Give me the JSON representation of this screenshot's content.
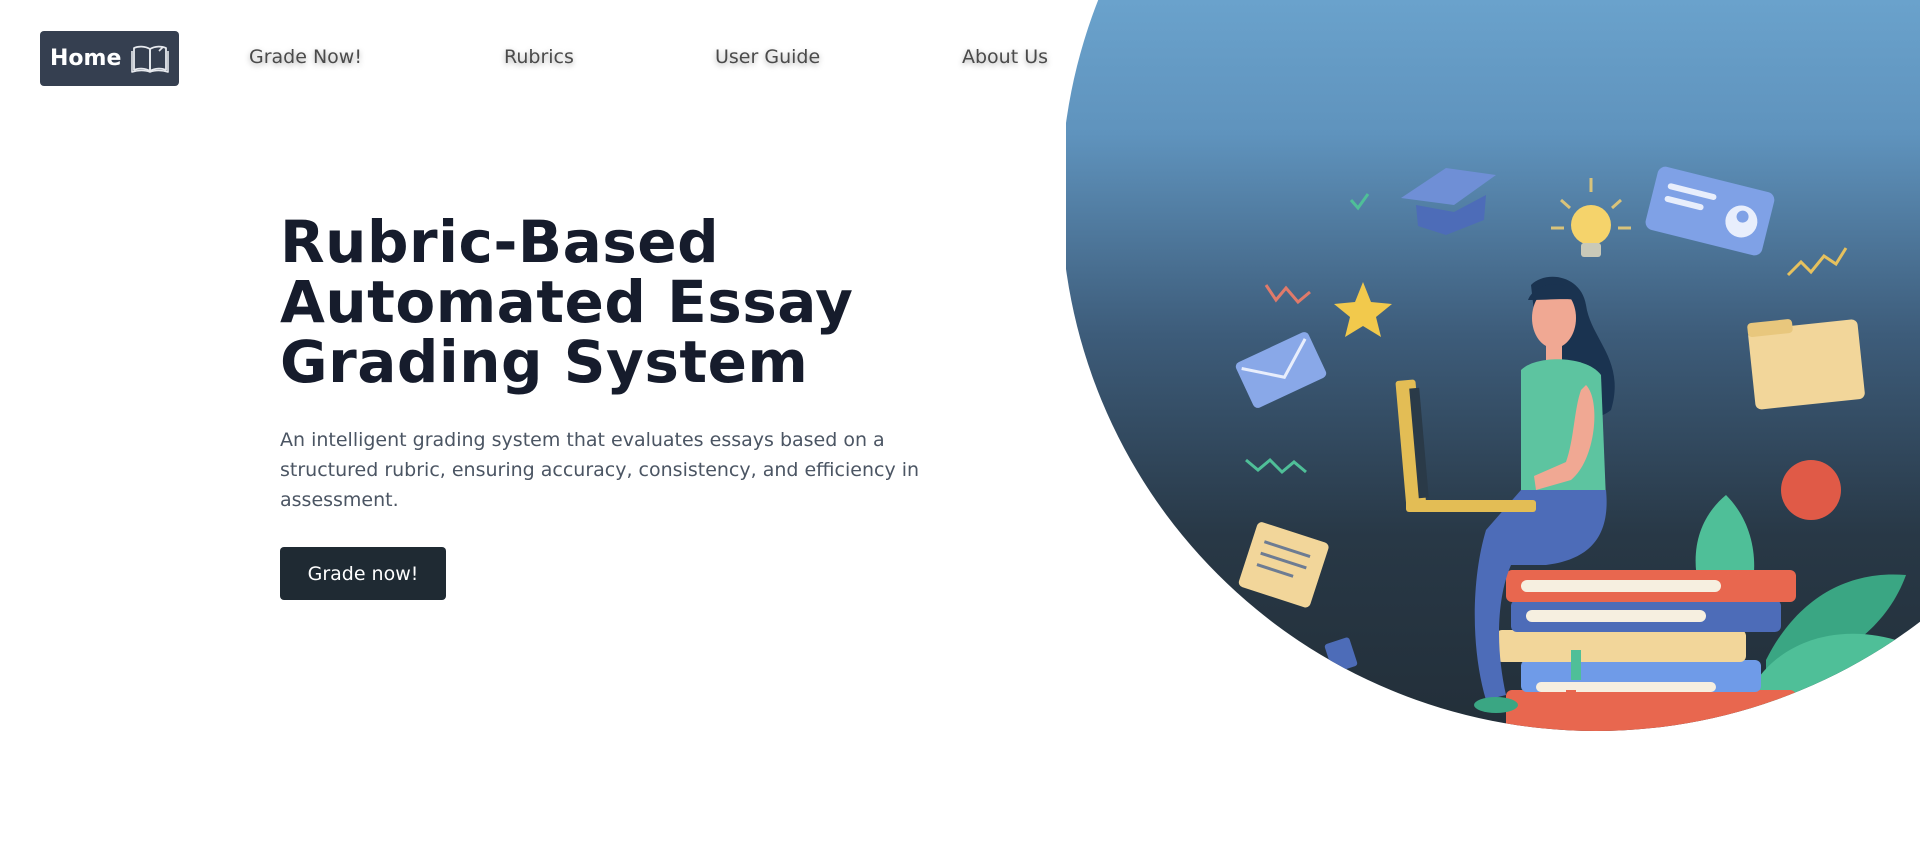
{
  "nav": {
    "home_label": "Home",
    "links": [
      "Grade Now!",
      "Rubrics",
      "User Guide",
      "About Us"
    ]
  },
  "hero": {
    "title_lines": [
      "Rubric-Based",
      "Automated Essay",
      "Grading System"
    ],
    "description": "An intelligent grading system that evaluates essays based on a structured rubric, ensuring accuracy, consistency, and efficiency in assessment.",
    "cta_label": "Grade now!"
  },
  "icons": {
    "home": "open-book-icon",
    "illustration": "student-with-laptop-on-books-illustration"
  },
  "colors": {
    "primary_dark": "#1f2a33",
    "home_bg": "#353f50",
    "title_text": "#161c2c",
    "body_text": "#4b5563",
    "illustration_sky_top": "#6aa2cc",
    "illustration_sky_bottom": "#253441"
  }
}
